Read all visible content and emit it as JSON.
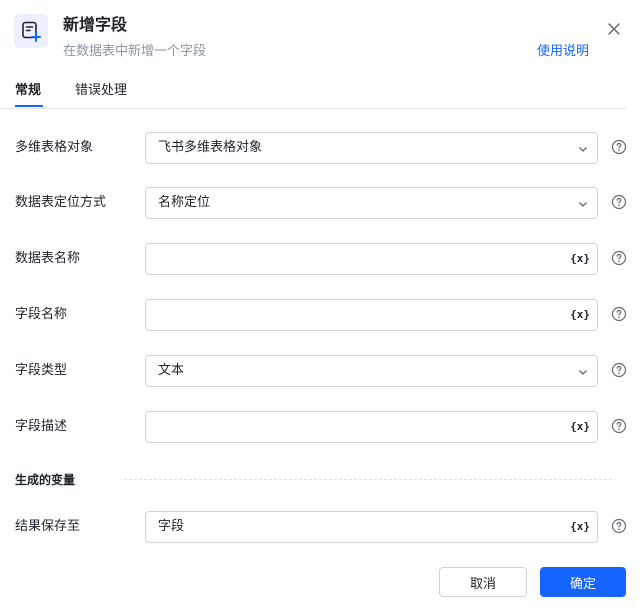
{
  "dialog": {
    "title": "新增字段",
    "subtitle": "在数据表中新增一个字段",
    "help_link": "使用说明"
  },
  "tabs": [
    {
      "label": "常规",
      "active": true
    },
    {
      "label": "错误处理",
      "active": false
    }
  ],
  "fields": [
    {
      "label": "多维表格对象",
      "value": "飞书多维表格对象",
      "kind": "select"
    },
    {
      "label": "数据表定位方式",
      "value": "名称定位",
      "kind": "select"
    },
    {
      "label": "数据表名称",
      "value": "",
      "kind": "variable"
    },
    {
      "label": "字段名称",
      "value": "",
      "kind": "variable"
    },
    {
      "label": "字段类型",
      "value": "文本",
      "kind": "select"
    },
    {
      "label": "字段描述",
      "value": "",
      "kind": "variable"
    }
  ],
  "output_section": {
    "label": "生成的变量",
    "fields": [
      {
        "label": "结果保存至",
        "value": "字段",
        "kind": "variable"
      }
    ]
  },
  "variable_icon_text": "{x}",
  "buttons": {
    "cancel": "取消",
    "confirm": "确定"
  },
  "colors": {
    "accent": "#1664ff",
    "icon_bg": "#eaf0ff",
    "border": "#d0d3d6",
    "muted_text": "#8f959e"
  },
  "icons": {
    "header": "table-add-icon",
    "close": "close-icon",
    "select": "chevron-down-icon",
    "help": "question-circle-icon",
    "variable": "variable-icon"
  }
}
